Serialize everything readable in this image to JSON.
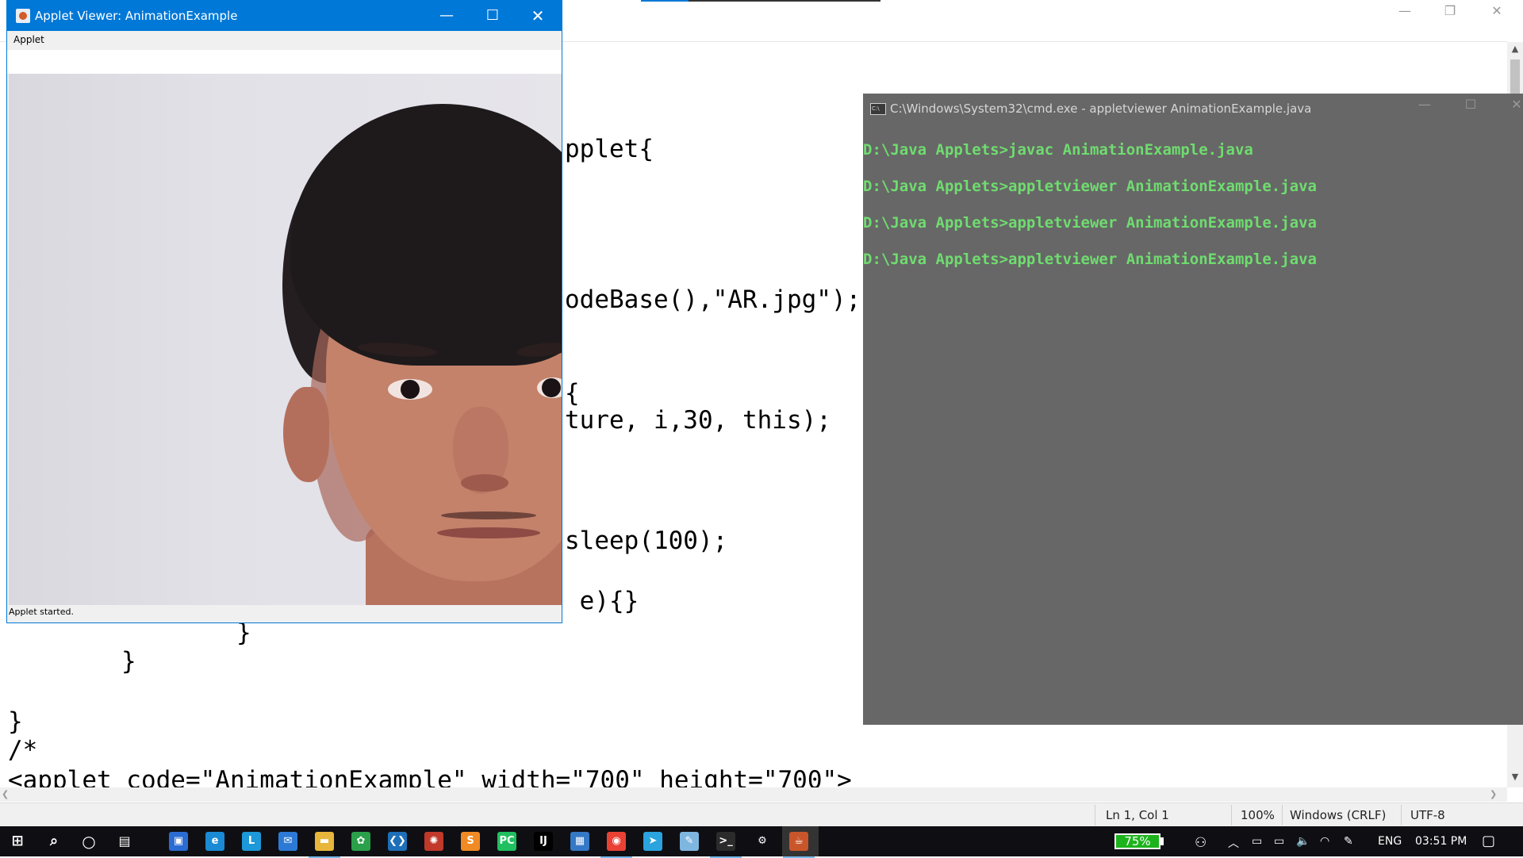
{
  "notepad": {
    "code_lines": [
      {
        "text": "pplet{"
      },
      {
        "text": "odeBase(),\"AR.jpg\");"
      },
      {
        "text": "{"
      },
      {
        "text": "ture, i,30, this);"
      },
      {
        "text": "sleep(100);"
      },
      {
        "text": " e){}"
      },
      {
        "text": "}"
      },
      {
        "text": "}"
      },
      {
        "text": "}"
      },
      {
        "text": "/*"
      },
      {
        "text": "<applet code=\"AnimationExample\" width=\"700\" height=\"700\">"
      }
    ],
    "status": {
      "position": "Ln 1, Col 1",
      "zoom": "100%",
      "line_ending": "Windows (CRLF)",
      "encoding": "UTF-8"
    }
  },
  "applet_window": {
    "title": "Applet Viewer: AnimationExample",
    "menu": "Applet",
    "status": "Applet started."
  },
  "cmd_window": {
    "title": "C:\\Windows\\System32\\cmd.exe - appletviewer  AnimationExample.java",
    "lines": [
      "D:\\Java Applets>javac AnimationExample.java",
      "D:\\Java Applets>appletviewer AnimationExample.java",
      "D:\\Java Applets>appletviewer AnimationExample.java",
      "D:\\Java Applets>appletviewer AnimationExample.java"
    ]
  },
  "taskbar": {
    "battery": "75%",
    "language": "ENG",
    "time": "03:51 PM",
    "apps": [
      {
        "icon": "store-icon",
        "glyph": "▣",
        "color": "#2b6cd4"
      },
      {
        "icon": "edge-icon",
        "glyph": "e",
        "color": "#1a8ad4"
      },
      {
        "icon": "app-l-icon",
        "glyph": "L",
        "color": "#1d98d8"
      },
      {
        "icon": "mail-icon",
        "glyph": "✉",
        "color": "#2d7ad6"
      },
      {
        "icon": "file-explorer-icon",
        "glyph": "▬",
        "color": "#e8b63a"
      },
      {
        "icon": "green-app-icon",
        "glyph": "✿",
        "color": "#2aa04a"
      },
      {
        "icon": "vscode-icon",
        "glyph": "❮❯",
        "color": "#1e6fb8"
      },
      {
        "icon": "gear-app-icon",
        "glyph": "✺",
        "color": "#c0392b"
      },
      {
        "icon": "sublime-icon",
        "glyph": "S",
        "color": "#f08a24"
      },
      {
        "icon": "pycharm-icon",
        "glyph": "PC",
        "color": "#20c060"
      },
      {
        "icon": "intellij-icon",
        "glyph": "IJ",
        "color": "#000000"
      },
      {
        "icon": "calendar-icon",
        "glyph": "▦",
        "color": "#3478c6"
      },
      {
        "icon": "chrome-icon",
        "glyph": "◉",
        "color": "#e94235"
      },
      {
        "icon": "telegram-icon",
        "glyph": "➤",
        "color": "#2aa3de"
      },
      {
        "icon": "notepad-icon",
        "glyph": "✎",
        "color": "#7fb6e0"
      },
      {
        "icon": "terminal-icon",
        "glyph": ">_",
        "color": "#2b2b2b"
      },
      {
        "icon": "settings-icon",
        "glyph": "⚙",
        "color": "#0f0f13"
      },
      {
        "icon": "java-icon",
        "glyph": "☕",
        "color": "#c9552a"
      }
    ]
  }
}
